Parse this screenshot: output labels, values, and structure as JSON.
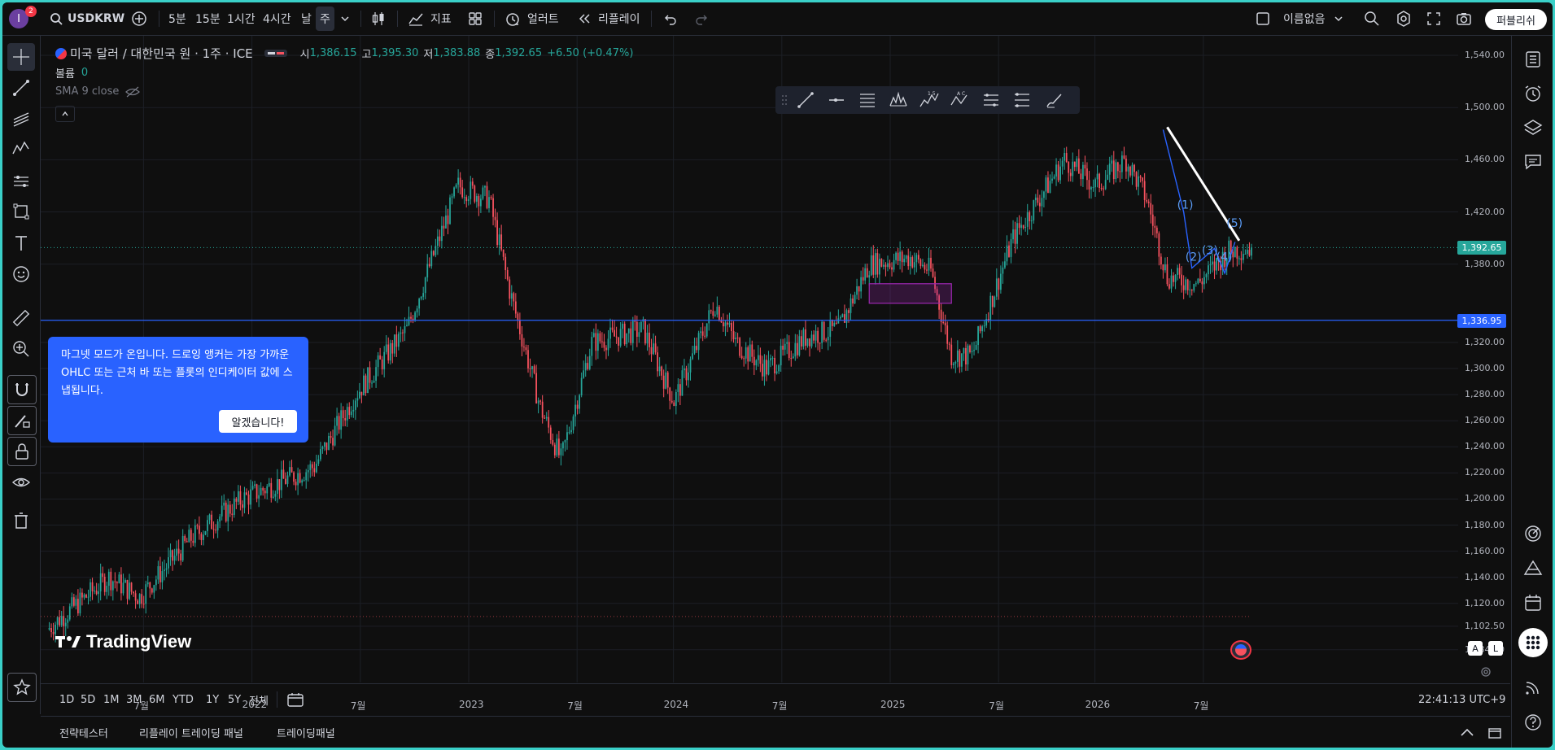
{
  "header": {
    "avatar_letter": "I",
    "notification_count": "2",
    "symbol": "USDKRW",
    "timeframes": [
      "5분",
      "15분",
      "1시간",
      "4시간",
      "날",
      "주"
    ],
    "active_timeframe": "주",
    "indicators_label": "지표",
    "alerts_label": "얼러트",
    "replay_label": "리플레이",
    "layout_name": "이름없음",
    "publish_label": "퍼블리쉬"
  },
  "legend": {
    "title": "미국 달러 / 대한민국 원 · 1주 · ICE",
    "open_label": "시",
    "open": "1,386.15",
    "high_label": "고",
    "high": "1,395.30",
    "low_label": "저",
    "low": "1,383.88",
    "close_label": "종",
    "close": "1,392.65",
    "change": "+6.50 (+0.47%)",
    "volume_label": "볼륨",
    "volume": "0",
    "sma_label": "SMA 9 close"
  },
  "popup": {
    "text": "마그넷 모드가 온입니다. 드로잉 앵커는 가장 가까운 OHLC 또는 근처 바 또는 플롯의 인디케이터 값에 스냅됩니다.",
    "button": "알겠습니다!"
  },
  "price_axis": {
    "labels": [
      "1,540.00",
      "1,500.00",
      "1,460.00",
      "1,420.00",
      "1,380.00",
      "1,320.00",
      "1,300.00",
      "1,280.00",
      "1,260.00",
      "1,240.00",
      "1,220.00",
      "1,200.00",
      "1,180.00",
      "1,160.00",
      "1,140.00",
      "1,120.00",
      "1,102.50",
      "1,084.50"
    ],
    "current_price": "1,392.65",
    "hline_price": "1,336.95"
  },
  "time_axis": {
    "labels": [
      "7월",
      "2022",
      "7월",
      "2023",
      "7월",
      "2024",
      "7월",
      "2025",
      "7월",
      "2026",
      "7월"
    ]
  },
  "wave_labels": [
    "(1)",
    "(2)",
    "(3)",
    "(4)",
    "(5)"
  ],
  "bottom": {
    "periods": [
      "1D",
      "5D",
      "1M",
      "3M",
      "6M",
      "YTD",
      "1Y",
      "5Y",
      "전체"
    ],
    "clock": "22:41:13 UTC+9",
    "scale_a": "A",
    "scale_l": "L"
  },
  "panels": [
    "전략테스터",
    "리플레이 트레이딩 패널",
    "트레이딩패널"
  ],
  "brand": "TradingView",
  "colors": {
    "up": "#26a69a",
    "down": "#f7525f",
    "accent": "#2962ff",
    "background": "#0f0f0f"
  },
  "chart_data": {
    "type": "candlestick",
    "symbol": "USDKRW",
    "interval": "1W",
    "ylim": [
      1075,
      1550
    ],
    "current_price": 1392.65,
    "horizontal_line": 1336.95,
    "anchors": [
      {
        "t": 0,
        "v": 1100
      },
      {
        "t": 30,
        "v": 1140
      },
      {
        "t": 45,
        "v": 1125
      },
      {
        "t": 70,
        "v": 1170
      },
      {
        "t": 95,
        "v": 1200
      },
      {
        "t": 130,
        "v": 1225
      },
      {
        "t": 150,
        "v": 1280
      },
      {
        "t": 175,
        "v": 1330
      },
      {
        "t": 200,
        "v": 1440
      },
      {
        "t": 215,
        "v": 1430
      },
      {
        "t": 225,
        "v": 1360
      },
      {
        "t": 240,
        "v": 1270
      },
      {
        "t": 250,
        "v": 1230
      },
      {
        "t": 265,
        "v": 1320
      },
      {
        "t": 290,
        "v": 1330
      },
      {
        "t": 305,
        "v": 1275
      },
      {
        "t": 325,
        "v": 1350
      },
      {
        "t": 335,
        "v": 1320
      },
      {
        "t": 350,
        "v": 1300
      },
      {
        "t": 370,
        "v": 1325
      },
      {
        "t": 385,
        "v": 1330
      },
      {
        "t": 400,
        "v": 1380
      },
      {
        "t": 420,
        "v": 1385
      },
      {
        "t": 430,
        "v": 1375
      },
      {
        "t": 440,
        "v": 1310
      },
      {
        "t": 450,
        "v": 1310
      },
      {
        "t": 470,
        "v": 1400
      },
      {
        "t": 495,
        "v": 1460
      },
      {
        "t": 510,
        "v": 1440
      },
      {
        "t": 525,
        "v": 1460
      },
      {
        "t": 535,
        "v": 1430
      },
      {
        "t": 545,
        "v": 1370
      },
      {
        "t": 560,
        "v": 1365
      },
      {
        "t": 575,
        "v": 1390
      },
      {
        "t": 586,
        "v": 1392.65
      }
    ]
  }
}
